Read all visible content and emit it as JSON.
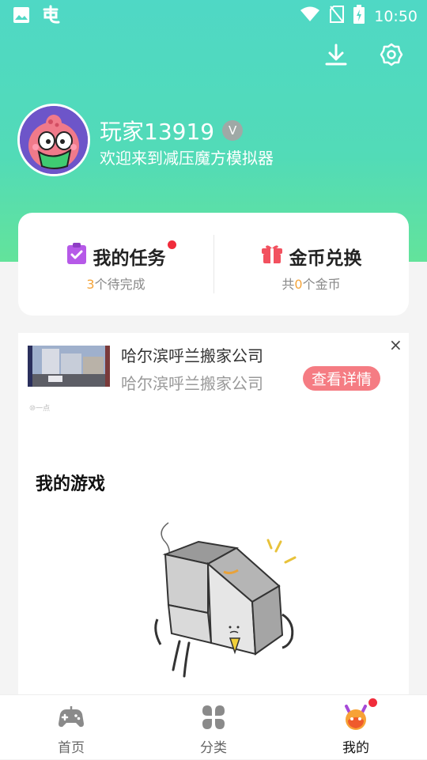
{
  "status_bar": {
    "time": "10:50"
  },
  "profile": {
    "username": "玩家13919",
    "vip_badge": "V",
    "welcome": "欢迎来到减压魔方模拟器"
  },
  "cards": {
    "tasks": {
      "title": "我的任务",
      "count": "3",
      "sub_suffix": "个待完成"
    },
    "coins": {
      "title": "金币兑换",
      "sub_prefix": "共",
      "count": "0",
      "sub_suffix": "个金币"
    }
  },
  "ad": {
    "title": "哈尔滨呼兰搬家公司",
    "description": "哈尔滨呼兰搬家公司",
    "button": "查看详情",
    "close": "×",
    "mark": "⑩一点"
  },
  "section": {
    "my_games": "我的游戏"
  },
  "tabbar": {
    "tabs": [
      {
        "label": "首页",
        "icon": "gamepad-icon",
        "active": false
      },
      {
        "label": "分类",
        "icon": "category-icon",
        "active": false
      },
      {
        "label": "我的",
        "icon": "devil-face-icon",
        "active": true
      }
    ]
  },
  "colors": {
    "header_gradient_top": "#4fd8c5",
    "header_gradient_bottom": "#63e39b",
    "accent_orange": "#f4a43a",
    "button_pink": "#f57c83",
    "badge_red": "#f02c3b"
  }
}
